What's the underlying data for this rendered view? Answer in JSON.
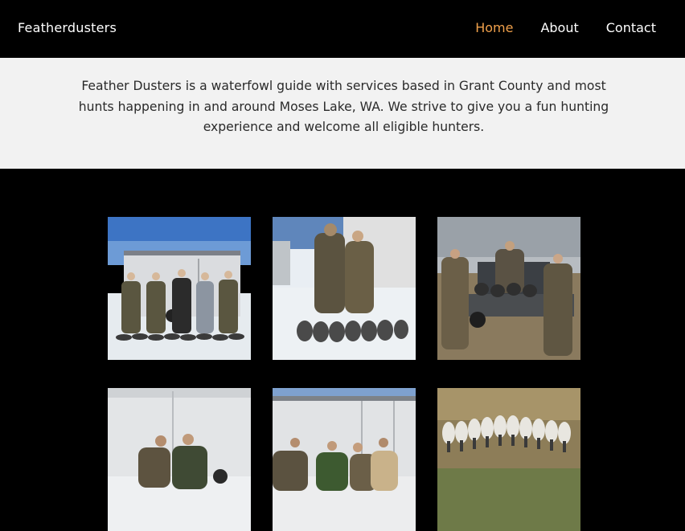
{
  "navbar": {
    "brand": "Featherdusters",
    "links": [
      {
        "label": "Home",
        "active": true
      },
      {
        "label": "About",
        "active": false
      },
      {
        "label": "Contact",
        "active": false
      }
    ],
    "accent_color": "#f0a04b"
  },
  "intro": {
    "text": "Feather Dusters is a waterfowl guide with services based in Grant County and most hunts happening in and around Moses Lake, WA. We strive to give you a fun hunting experience and welcome all eligible hunters."
  },
  "gallery": {
    "photos": [
      {
        "subject": "five hunters with geese in front of white trailer in snow"
      },
      {
        "subject": "two hunters in camo with geese in snow by trailer"
      },
      {
        "subject": "three hunters with geese on truck tailgate"
      },
      {
        "subject": "two hunters kneeling in front of white trailer"
      },
      {
        "subject": "four hunters kneeling in front of white trailer"
      },
      {
        "subject": "row of geese laid out on dry grass"
      }
    ]
  }
}
